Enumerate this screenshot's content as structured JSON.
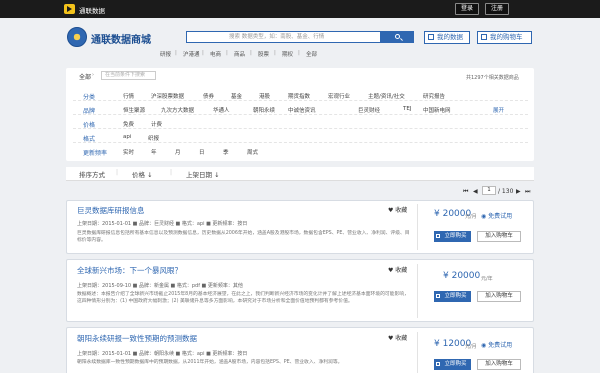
{
  "topbar": {
    "brand": "通联数据",
    "login": "登录",
    "register": "注册"
  },
  "header": {
    "site_name": "通联数据商城",
    "search_placeholder": "搜索 数据类型，如：南股、基金、行情",
    "my_data": "我的数据",
    "my_cart": "我的购物车",
    "quick_links": [
      "研报",
      "沪港通",
      "电商",
      "商品",
      "股票",
      "期权",
      "全部"
    ]
  },
  "filter": {
    "all_label": "全部",
    "input_placeholder": "在当前条件下搜索",
    "count_text": "共1297个相关数据商品",
    "rows": [
      {
        "label": "分类",
        "options": [
          "行情",
          "沪深股票数据",
          "债券",
          "基金",
          "港股",
          "期货指数",
          "宏观行业",
          "主题/资讯/社交",
          "研究报告"
        ]
      },
      {
        "label": "品牌",
        "options": [
          "恒生聚源",
          "九次方大数据",
          "华通人",
          "朝阳永续",
          "中诚信资讯",
          "巨灵财经",
          "TEJ",
          "中国新电网"
        ],
        "more": "展开"
      },
      {
        "label": "价格",
        "options": [
          "免费",
          "计费"
        ]
      },
      {
        "label": "格式",
        "options": [
          "api",
          "织报"
        ]
      },
      {
        "label": "更新频率",
        "options": [
          "实时",
          "年",
          "月",
          "日",
          "季",
          "周式"
        ]
      }
    ]
  },
  "sort": {
    "label": "排序方式",
    "tabs": [
      "价格 ↓",
      "上架日期 ↓"
    ]
  },
  "pager": {
    "first": "⏮",
    "prev": "◀",
    "page": "1",
    "total": "/ 130",
    "next": "▶",
    "last": "⏭"
  },
  "products": [
    {
      "title": "巨灵数据库研报信息",
      "fav": "收藏",
      "meta": "上架日期：2015-01-01  ■ 品牌：巨灵财经  ■ 格式：api  ■ 更新频率：按日",
      "desc": "巨灵数据库研报信息包括所有基本信息以及预测数据信息，历史数据从2006年开始，涵盖A股及港股市场，数据包含EPS、PE、营业收入、净利润、评级、目标价等内容。",
      "price": "20000",
      "unit": "元/月",
      "trial": "免费试用",
      "buy": "立即购买",
      "cart": "加入购物车"
    },
    {
      "title": "全球新兴市场：下一个暴风眼？",
      "fav": "收藏",
      "meta": "上架日期：2015-09-10  ■ 品牌：新金属  ■ 格式：pdf  ■ 更新频率：其他",
      "desc": "数据概述：本报告介绍了全球新兴市场截止2015年8月的基本经济展望，在此之上，我们判断新兴经济市场的变化计并了解上述经济基本面环境的可能影响，这四种情形分别为：(1) 中国政府大幅刺激；(2) 美联储升息等多方面影响，本研究对于市场分析和全面价值地预判都有参考价值。",
      "price": "20000",
      "unit": "元/年",
      "buy": "立即购买",
      "cart": "加入购物车"
    },
    {
      "title": "朝阳永续研报一致性预期的预测数据",
      "fav": "收藏",
      "meta": "上架日期：2015-01-01  ■ 品牌：朝阳永续  ■ 格式：api  ■ 更新频率：按日",
      "desc": "朝阳永续数据库一致性预期数据库中的预期数据，从2011年开始，涵盖A股市场，内容包括EPS、PE、营业收入、净利润等。",
      "price": "12000",
      "unit": "元/月",
      "trial": "免费试用",
      "buy": "立即购买",
      "cart": "加入购物车"
    }
  ]
}
